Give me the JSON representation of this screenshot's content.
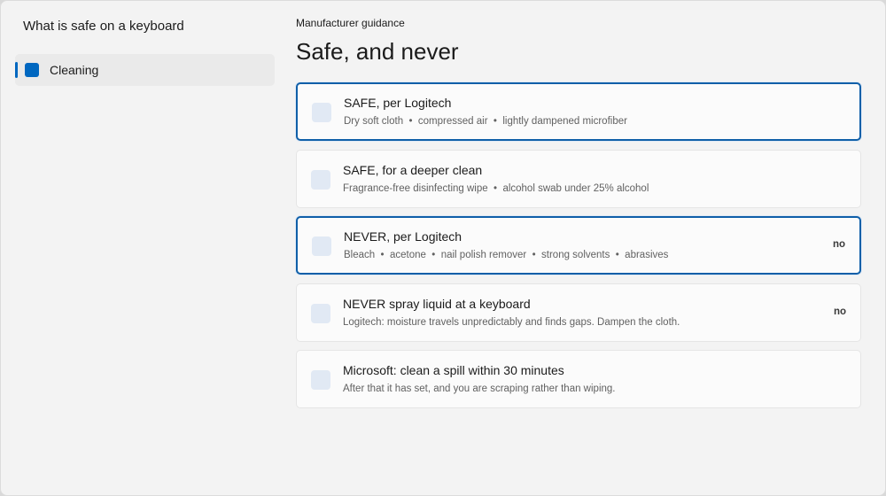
{
  "sidebar": {
    "title": "What is safe on a keyboard",
    "items": [
      {
        "label": "Cleaning",
        "selected": true
      }
    ]
  },
  "main": {
    "subheader": "Manufacturer guidance",
    "title": "Safe, and never",
    "cards": [
      {
        "title": "SAFE, per Logitech",
        "description": "Dry soft cloth  •  compressed air  •  lightly dampened microfiber",
        "badge": "",
        "selected": true
      },
      {
        "title": "SAFE, for a deeper clean",
        "description": "Fragrance-free disinfecting wipe  •  alcohol swab under 25% alcohol",
        "badge": "",
        "selected": false
      },
      {
        "title": "NEVER, per Logitech",
        "description": "Bleach  •  acetone  •  nail polish remover  •  strong solvents  •  abrasives",
        "badge": "no",
        "selected": true
      },
      {
        "title": "NEVER spray liquid at a keyboard",
        "description": "Logitech: moisture travels unpredictably and finds gaps. Dampen the cloth.",
        "badge": "no",
        "selected": false
      },
      {
        "title": "Microsoft: clean a spill within 30 minutes",
        "description": "After that it has set, and you are scraping rather than wiping.",
        "badge": "",
        "selected": false
      }
    ]
  },
  "colors": {
    "accent": "#0067c0",
    "selected_border": "#0f5fa8",
    "checkbox": "#e1e9f4"
  }
}
